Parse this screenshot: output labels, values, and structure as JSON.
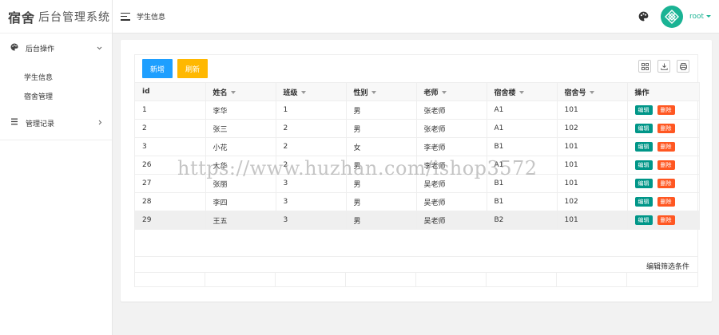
{
  "logo": {
    "strong": "宿舍",
    "rest": "后台管理系统"
  },
  "sidebar": {
    "groups": [
      {
        "label": "后台操作",
        "icon": "palette-icon",
        "expanded": true,
        "items": [
          {
            "label": "学生信息"
          },
          {
            "label": "宿舍管理"
          }
        ]
      },
      {
        "label": "管理记录",
        "icon": "list-icon",
        "expanded": false,
        "items": []
      }
    ]
  },
  "header": {
    "title": "学生信息",
    "user": "root"
  },
  "toolbar": {
    "add_label": "新增",
    "refresh_label": "刷新"
  },
  "table": {
    "columns": [
      "id",
      "姓名",
      "班级",
      "性别",
      "老师",
      "宿舍楼",
      "宿舍号",
      "操作"
    ],
    "rows": [
      [
        "1",
        "李华",
        "1",
        "男",
        "张老师",
        "A1",
        "101"
      ],
      [
        "2",
        "张三",
        "2",
        "男",
        "张老师",
        "A1",
        "102"
      ],
      [
        "3",
        "小花",
        "2",
        "女",
        "李老师",
        "B1",
        "101"
      ],
      [
        "26",
        "大华",
        "2",
        "男",
        "李老师",
        "A1",
        "101"
      ],
      [
        "27",
        "张丽",
        "3",
        "男",
        "吴老师",
        "B1",
        "101"
      ],
      [
        "28",
        "李四",
        "3",
        "男",
        "吴老师",
        "B1",
        "102"
      ],
      [
        "29",
        "王五",
        "3",
        "男",
        "吴老师",
        "B2",
        "101"
      ]
    ],
    "edit_label": "编辑",
    "delete_label": "删除",
    "active_row": 6
  },
  "footer": {
    "filter_label": "编辑筛选条件"
  },
  "watermark": "https://www.huzhan.com/ishop3572",
  "colors": {
    "primary": "#1e9fff",
    "warning": "#ffb800",
    "edit": "#009688",
    "delete": "#ff5722",
    "accent": "#1ab394"
  }
}
